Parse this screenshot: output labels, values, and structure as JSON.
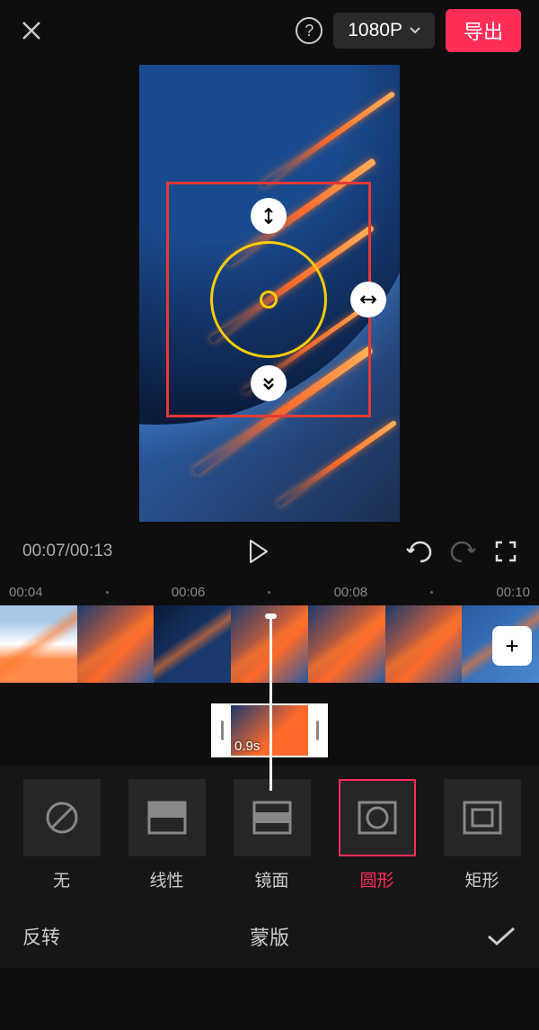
{
  "header": {
    "resolution": "1080P",
    "export_label": "导出"
  },
  "playback": {
    "current_time": "00:07",
    "total_time": "00:13"
  },
  "timeline": {
    "ruler_marks": [
      "00:04",
      "00:06",
      "00:08",
      "00:10"
    ]
  },
  "selected_clip": {
    "duration": "0.9s"
  },
  "mask_options": [
    {
      "id": "none",
      "label": "无"
    },
    {
      "id": "linear",
      "label": "线性"
    },
    {
      "id": "mirror",
      "label": "镜面"
    },
    {
      "id": "circle",
      "label": "圆形"
    },
    {
      "id": "rect",
      "label": "矩形"
    }
  ],
  "selected_mask": "circle",
  "bottom": {
    "invert_label": "反转",
    "title": "蒙版"
  }
}
